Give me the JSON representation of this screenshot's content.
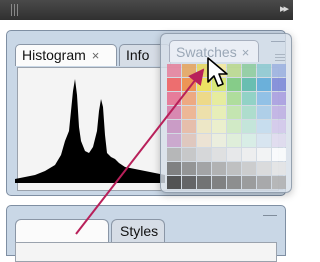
{
  "topbar": {
    "collapse_label": "▸▸"
  },
  "panel1": {
    "tabs": [
      {
        "label": "Histogram",
        "close": "×"
      },
      {
        "label": "Info"
      }
    ]
  },
  "swatches": {
    "tab_label": "Swatches",
    "close": "×",
    "minimize": "—",
    "colors": [
      "#e67f9a",
      "#e6a35a",
      "#e6d85a",
      "#f7ea9a",
      "#b9d98a",
      "#8ccc9c",
      "#8cc9d0",
      "#9bb1e0",
      "#f05a5a",
      "#f0883c",
      "#f0e24c",
      "#d8e864",
      "#78c878",
      "#56b8a8",
      "#58a8d8",
      "#7a86d8",
      "#e86c8c",
      "#f0a070",
      "#f0d878",
      "#e8ee92",
      "#a8dc90",
      "#86d0c0",
      "#86bce6",
      "#a89ce0",
      "#d87aa8",
      "#f0b088",
      "#f0e0a0",
      "#eaf0b0",
      "#c0e6a8",
      "#a6dcc8",
      "#a8cce8",
      "#c0b0e4",
      "#c890c0",
      "#e8b8a0",
      "#f0e8c0",
      "#eef2c8",
      "#d0ecc0",
      "#c0e6d8",
      "#c4dcef",
      "#d4c8ec",
      "#c9a0c9",
      "#e0c4b8",
      "#efe4d0",
      "#eef0dc",
      "#e0f0d8",
      "#d8efe6",
      "#d8e6f2",
      "#e2dcf0",
      "#b0b0b0",
      "#c4c4c4",
      "#d6d6d6",
      "#e0e0e0",
      "#eaeaea",
      "#f0f0f0",
      "#f6f6f6",
      "#ffffff",
      "#707070",
      "#888888",
      "#9a9a9a",
      "#aaaaaa",
      "#bababa",
      "#cacaca",
      "#dadada",
      "#e6e6e6",
      "#3a3a3a",
      "#505050",
      "#606060",
      "#707070",
      "#808080",
      "#909090",
      "#a0a0a0",
      "#b0b0b0"
    ]
  },
  "panel2": {
    "tabs": [
      {
        "label": ""
      },
      {
        "label": "Styles"
      }
    ],
    "minimize": "—"
  },
  "annotation": {
    "arrow_color": "#b8205a"
  }
}
